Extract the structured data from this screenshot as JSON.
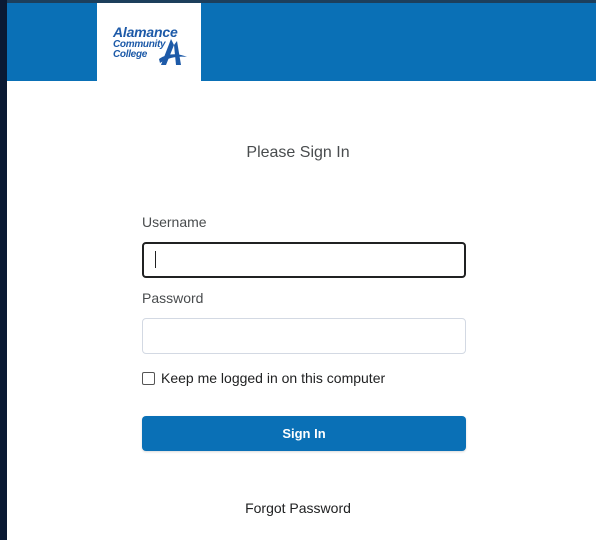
{
  "header": {
    "logo": {
      "line1": "Alamance",
      "line2": "Community",
      "line3": "College"
    },
    "bar_color": "#0a70b6"
  },
  "login": {
    "heading": "Please Sign In",
    "username_label": "Username",
    "username_value": "",
    "password_label": "Password",
    "password_value": "",
    "remember_label": "Keep me logged in on this computer",
    "remember_checked": false,
    "signin_label": "Sign In",
    "forgot_label": "Forgot Password"
  },
  "icons": {
    "logo_mark": "acc-logo-a-icon"
  }
}
